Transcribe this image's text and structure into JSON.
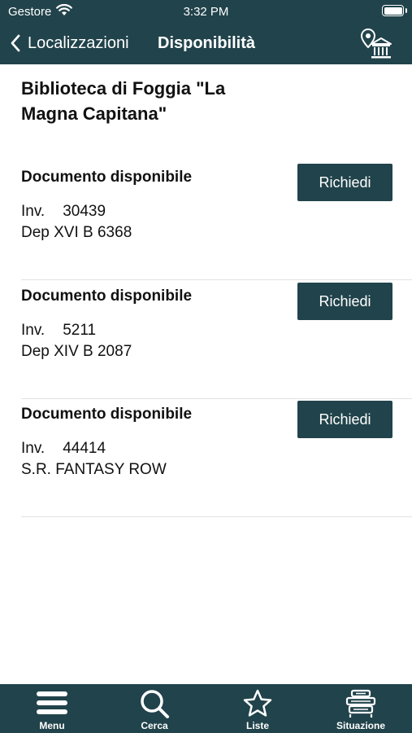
{
  "status_bar": {
    "carrier": "Gestore",
    "time": "3:32 PM"
  },
  "nav": {
    "back_label": "Localizzazioni",
    "title": "Disponibilità"
  },
  "library_name": "Biblioteca di Foggia \"La Magna Capitana\"",
  "items": [
    {
      "status": "Documento disponibile",
      "inv_label": "Inv.",
      "inv_number": "30439",
      "location": "Dep XVI B 6368",
      "button": "Richiedi"
    },
    {
      "status": "Documento disponibile",
      "inv_label": "Inv.",
      "inv_number": "5211",
      "location": "Dep XIV B 2087",
      "button": "Richiedi"
    },
    {
      "status": "Documento disponibile",
      "inv_label": "Inv.",
      "inv_number": "44414",
      "location": "S.R. FANTASY ROW",
      "button": "Richiedi"
    }
  ],
  "tabs": [
    {
      "label": "Menu",
      "icon": "menu-icon"
    },
    {
      "label": "Cerca",
      "icon": "search-icon"
    },
    {
      "label": "Liste",
      "icon": "star-icon"
    },
    {
      "label": "Situazione",
      "icon": "books-stack-icon"
    }
  ],
  "colors": {
    "primary": "#21434b",
    "separator": "#e2e2e2"
  }
}
